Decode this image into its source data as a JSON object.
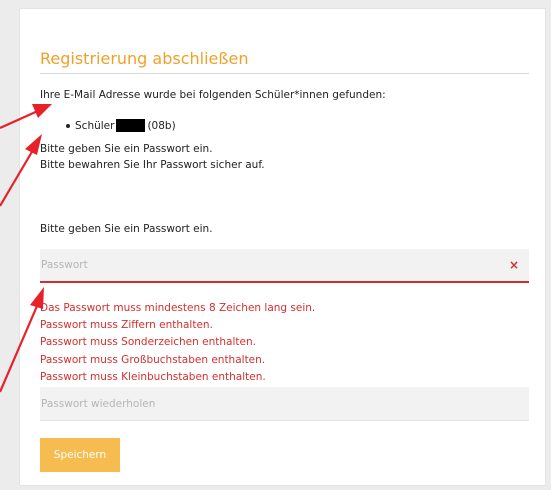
{
  "form": {
    "title": "Registrierung abschließen",
    "found_text": "Ihre E-Mail Adresse wurde bei folgenden Schüler*innen gefunden:",
    "student_prefix": "Schüler",
    "student_class": "(08b)",
    "instruction_1": "Bitte geben Sie ein Passwort ein.",
    "instruction_2": "Bitte bewahren Sie Ihr Passwort sicher auf.",
    "password_label": "Bitte geben Sie ein Passwort ein.",
    "password_placeholder": "Passwort",
    "password_value": "",
    "error_icon": "×",
    "errors": [
      "Das Passwort muss mindestens 8 Zeichen lang sein.",
      "Passwort muss Ziffern enthalten.",
      "Passwort muss Sonderzeichen enthalten.",
      "Passwort muss Großbuchstaben enthalten.",
      "Passwort muss Kleinbuchstaben enthalten."
    ],
    "repeat_placeholder": "Passwort wiederholen",
    "repeat_value": "",
    "save_label": "Speichern"
  },
  "colors": {
    "title": "#f0a02a",
    "error": "#d32f2f",
    "button": "#f6bc4f",
    "annotation_arrow": "#e8202a"
  },
  "icons": {
    "error_icon": "close-icon",
    "redaction": "redacted-name-box"
  }
}
